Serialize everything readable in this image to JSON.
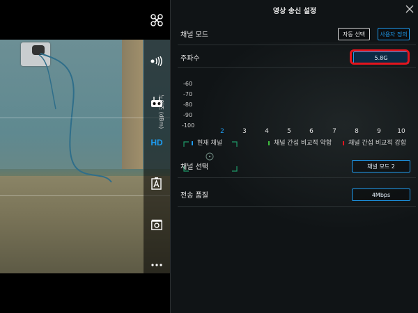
{
  "panel": {
    "title": "영상 송신 설정"
  },
  "channel_mode": {
    "label": "채널 모드",
    "auto_label": "자동 선택",
    "custom_label": "사용자 정의"
  },
  "frequency": {
    "label": "주파수",
    "value": "5.8G"
  },
  "chart_data": {
    "type": "bar",
    "ylabel": "노이즈 (dBm)",
    "y_ticks": [
      "-60",
      "-70",
      "-80",
      "-90",
      "-100"
    ],
    "ylim": [
      -100,
      -60
    ],
    "categories": [
      "2",
      "3",
      "4",
      "5",
      "6",
      "7",
      "8",
      "9",
      "10"
    ],
    "active_category": "2",
    "legend": [
      {
        "label": "현재 채널",
        "color": "#1e9cf0"
      },
      {
        "label": "채널 간섭 비교적 약함",
        "color": "#3fbf3f"
      },
      {
        "label": "채널 간섭 비교적 강함",
        "color": "#e3141d"
      }
    ]
  },
  "channel_select": {
    "label": "채널 선택",
    "value": "채널 모드 2"
  },
  "quality": {
    "label": "전송 품질",
    "value": "4Mbps"
  },
  "toolbar": {
    "hd_label": "HD"
  },
  "colors": {
    "accent": "#1e9cf0",
    "highlight": "#e3141d"
  }
}
